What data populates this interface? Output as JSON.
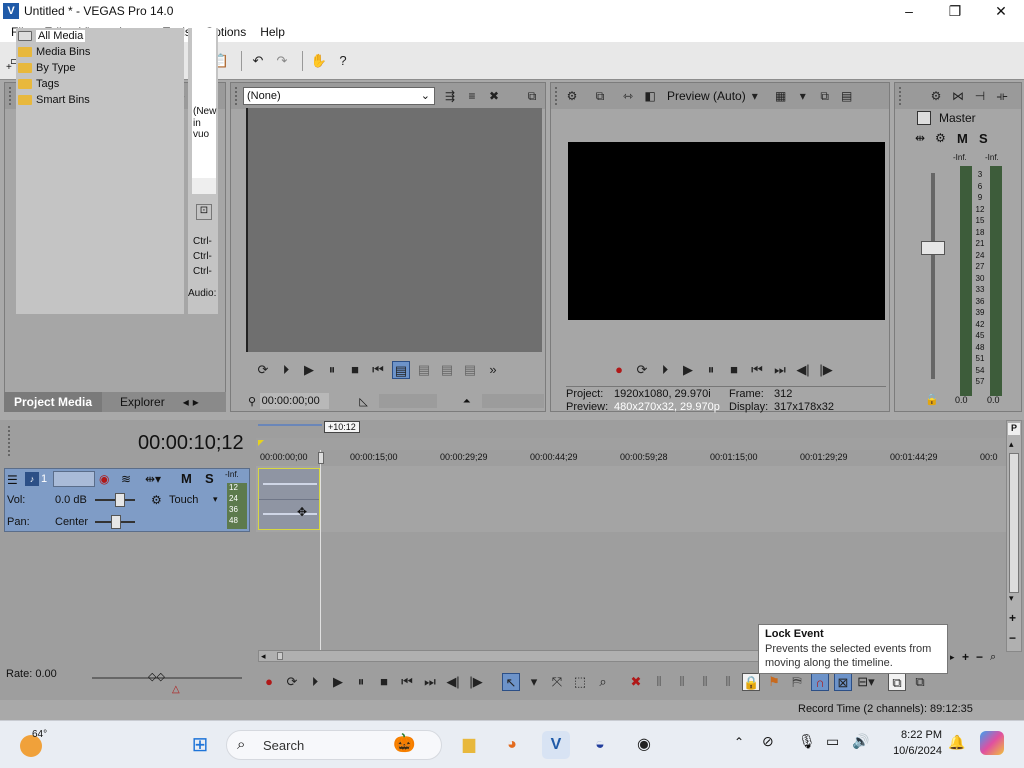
{
  "window": {
    "title": "Untitled * - VEGAS Pro 14.0"
  },
  "menu": [
    "File",
    "Edit",
    "View",
    "Insert",
    "Tools",
    "Options",
    "Help"
  ],
  "media": {
    "tree": [
      "All Media",
      "Media Bins",
      "By Type",
      "Tags",
      "Smart Bins"
    ],
    "expand_glyph": "+",
    "thumb_text_1": "(New",
    "thumb_text_2": "in vuo",
    "ctrl1": "Ctrl-",
    "ctrl2": "Ctrl-",
    "ctrl3": "Ctrl-",
    "audio": "Audio:",
    "tabs": {
      "project_media": "Project Media",
      "explorer": "Explorer"
    }
  },
  "trimmer": {
    "dropdown_value": "(None)",
    "timecode": "00:00:00;00"
  },
  "preview": {
    "mode": "Preview (Auto)",
    "project_label": "Project:",
    "project_value": "1920x1080, 29.970i",
    "preview_label": "Preview:",
    "preview_value": "480x270x32, 29.970p",
    "frame_label": "Frame:",
    "frame_value": "312",
    "display_label": "Display:",
    "display_value": "317x178x32"
  },
  "master": {
    "title": "Master",
    "m": "M",
    "s": "S",
    "inf_left": "-Inf.",
    "inf_right": "-Inf.",
    "scale": [
      "3",
      "6",
      "9",
      "12",
      "15",
      "18",
      "21",
      "24",
      "27",
      "30",
      "33",
      "36",
      "39",
      "42",
      "45",
      "48",
      "51",
      "54",
      "57"
    ],
    "bottom_left": "0.0",
    "bottom_right": "0.0"
  },
  "timeline": {
    "time": "00:00:10;12",
    "offset_badge": "+10:12",
    "ruler": [
      "00:00:00;00",
      "00:00:15;00",
      "00:00:29;29",
      "00:00:44;29",
      "00:00:59;28",
      "00:01:15;00",
      "00:01:29;29",
      "00:01:44;29",
      "00:0"
    ],
    "track": {
      "number": "1",
      "m": "M",
      "s": "S",
      "inf": "-Inf.",
      "vol_label": "Vol:",
      "vol_value": "0.0 dB",
      "pan_label": "Pan:",
      "pan_value": "Center",
      "automation": "Touch",
      "scale": [
        "12",
        "24",
        "36",
        "48"
      ]
    },
    "rate_label": "Rate: 0.00"
  },
  "tooltip": {
    "title": "Lock Event",
    "body": "Prevents the selected events from moving along the timeline."
  },
  "status": {
    "record_time": "Record Time (2 channels): 89:12:35"
  },
  "taskbar": {
    "weather": "64°",
    "search_placeholder": "Search",
    "time": "8:22 PM",
    "date": "10/6/2024"
  }
}
